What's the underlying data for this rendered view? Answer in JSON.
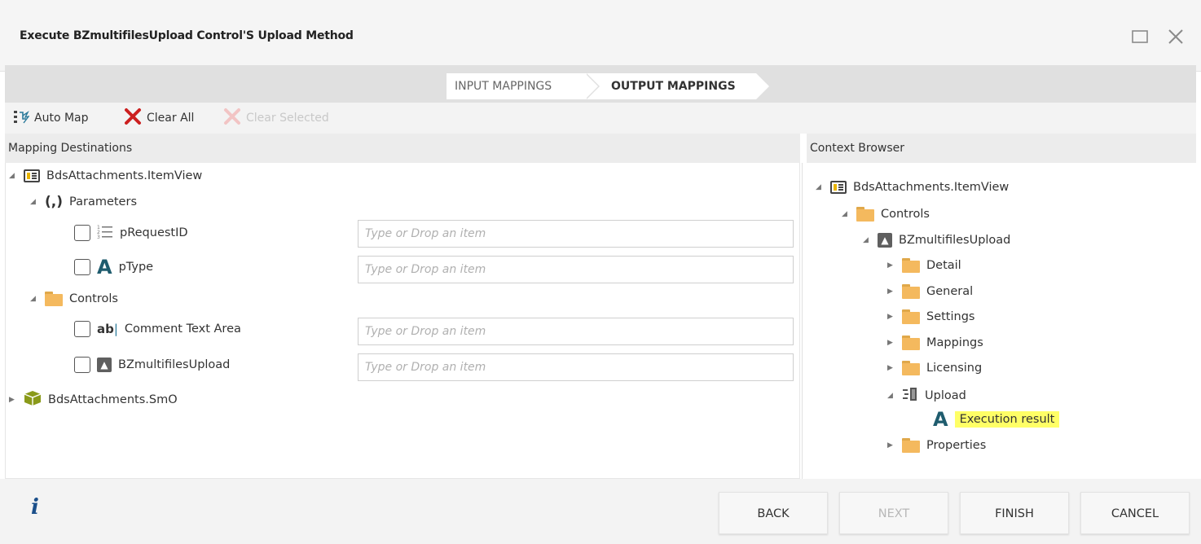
{
  "window": {
    "title": "Execute BZmultifilesUpload Control'S Upload Method"
  },
  "steps": [
    {
      "label": "INPUT MAPPINGS"
    },
    {
      "label": "OUTPUT MAPPINGS"
    }
  ],
  "toolbar": {
    "auto_map": "Auto Map",
    "clear_all": "Clear All",
    "clear_selected": "Clear Selected"
  },
  "left_panel": {
    "header": "Mapping Destinations",
    "root": "BdsAttachments.ItemView",
    "parameters_label": "Parameters",
    "parameters": [
      {
        "label": "pRequestID"
      },
      {
        "label": "pType"
      }
    ],
    "controls_label": "Controls",
    "controls": [
      {
        "label": "Comment Text Area"
      },
      {
        "label": "BZmultifilesUpload"
      }
    ],
    "smo": "BdsAttachments.SmO",
    "input_placeholder": "Type or Drop an item"
  },
  "right_panel": {
    "header": "Context Browser",
    "root": "BdsAttachments.ItemView",
    "controls": "Controls",
    "control": "BZmultifilesUpload",
    "folders": [
      {
        "label": "Detail"
      },
      {
        "label": "General"
      },
      {
        "label": "Settings"
      },
      {
        "label": "Mappings"
      },
      {
        "label": "Licensing"
      }
    ],
    "upload": "Upload",
    "execution_result": "Execution result",
    "properties": "Properties"
  },
  "footer": {
    "back": "BACK",
    "next": "NEXT",
    "finish": "FINISH",
    "cancel": "CANCEL"
  },
  "colors": {
    "highlight": "#ffff66",
    "delete_red": "#cc1f1f",
    "text_icon_teal": "#1f5c6e",
    "info_blue": "#1b4f8a"
  }
}
